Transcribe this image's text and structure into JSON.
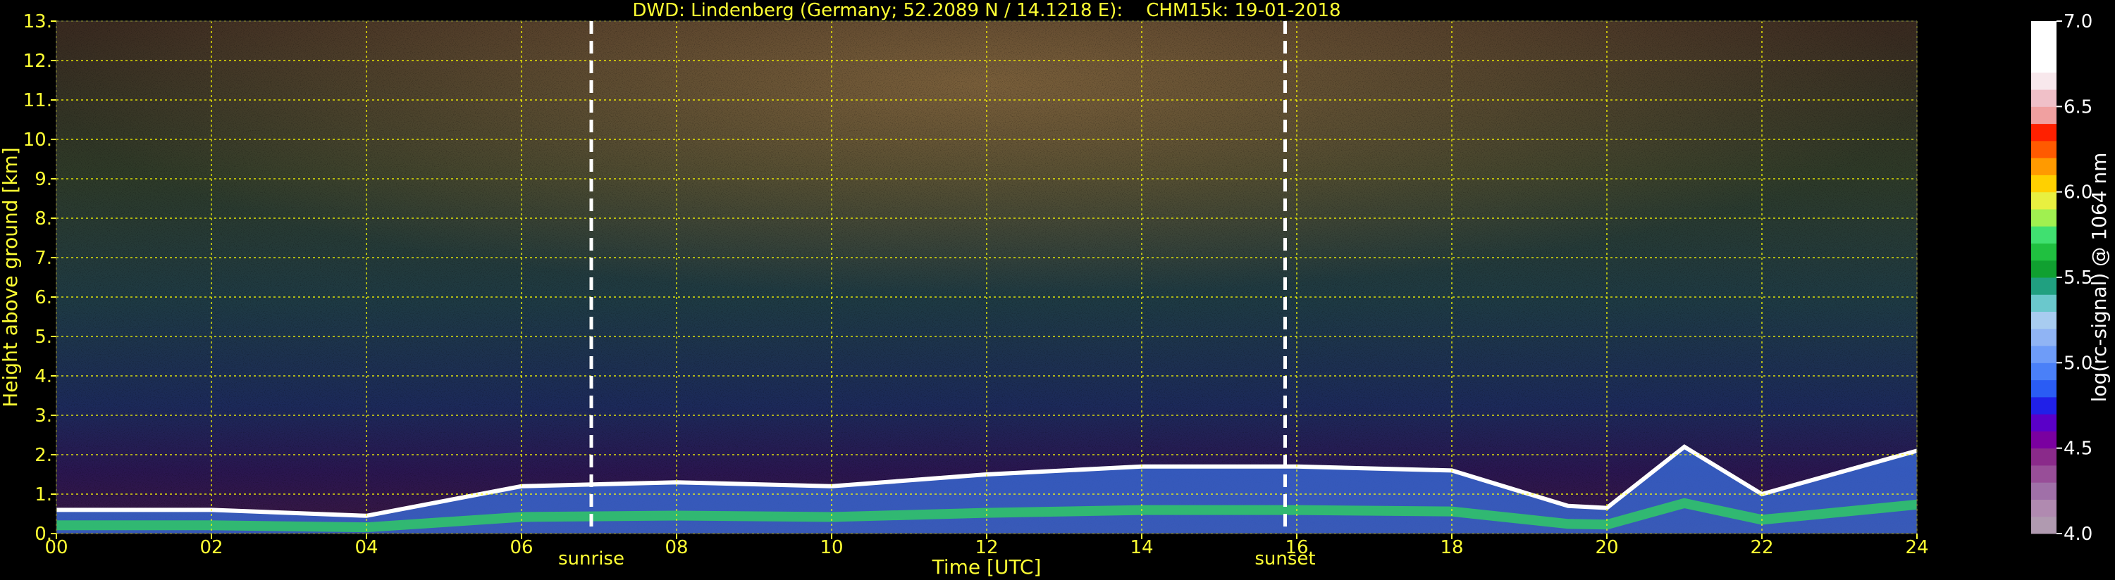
{
  "colors": {
    "background": "#000000",
    "text": "#ffff33",
    "grid": "#ffff00",
    "sun_lines": "#ffffff",
    "colorbar_text": "#ffffff"
  },
  "chart_data": {
    "type": "heatmap",
    "title": "DWD: Lindenberg (Germany; 52.2089 N / 14.1218 E):    CHM15k: 19-01-2018",
    "xlabel": "Time [UTC]",
    "ylabel": "Height above ground [km]",
    "xlim": [
      0,
      24
    ],
    "ylim": [
      0,
      13
    ],
    "x_ticks": [
      0,
      2,
      4,
      6,
      8,
      10,
      12,
      14,
      16,
      18,
      20,
      22,
      24
    ],
    "x_tick_labels": [
      "00",
      "02",
      "04",
      "06",
      "08",
      "10",
      "12",
      "14",
      "16",
      "18",
      "20",
      "22",
      "24"
    ],
    "y_ticks": [
      0,
      1,
      2,
      3,
      4,
      5,
      6,
      7,
      8,
      9,
      10,
      11,
      12,
      13
    ],
    "y_tick_labels": [
      "0.",
      "1.",
      "2.",
      "3.",
      "4.",
      "5.",
      "6.",
      "7.",
      "8.",
      "9.",
      "10.",
      "11.",
      "12.",
      "13."
    ],
    "grid": true,
    "markers": [
      {
        "label": "sunrise",
        "time": 6.9
      },
      {
        "label": "sunset",
        "time": 15.85
      }
    ],
    "colorbar": {
      "label": "log(rc-signal) @ 1064 nm",
      "range": [
        4.0,
        7.0
      ],
      "ticks": [
        4.0,
        4.5,
        5.0,
        5.5,
        6.0,
        6.5,
        7.0
      ],
      "tick_labels": [
        "4.0",
        "4.5",
        "5.0",
        "5.5",
        "6.0",
        "6.5",
        "7.0"
      ],
      "colors": [
        "#b09ab0",
        "#b08ab0",
        "#a070a8",
        "#984e98",
        "#8a2a8a",
        "#7a00a0",
        "#5a00c8",
        "#2020e8",
        "#2a5cf4",
        "#4a80f8",
        "#6e9cf8",
        "#90b4f4",
        "#a8ccf0",
        "#6ac8cc",
        "#20a080",
        "#10a030",
        "#20c040",
        "#40e070",
        "#a0f050",
        "#e8f040",
        "#ffd000",
        "#ff9a00",
        "#ff5a00",
        "#ff2000",
        "#f0a0a0",
        "#f0c0c8",
        "#f8e8ec",
        "#ffffff",
        "#ffffff",
        "#ffffff"
      ]
    },
    "boundary_layer_top_km": [
      {
        "time": 0.0,
        "height": 0.6
      },
      {
        "time": 2.0,
        "height": 0.6
      },
      {
        "time": 4.0,
        "height": 0.45
      },
      {
        "time": 6.0,
        "height": 1.2
      },
      {
        "time": 8.0,
        "height": 1.3
      },
      {
        "time": 10.0,
        "height": 1.2
      },
      {
        "time": 12.0,
        "height": 1.5
      },
      {
        "time": 14.0,
        "height": 1.7
      },
      {
        "time": 16.0,
        "height": 1.7
      },
      {
        "time": 18.0,
        "height": 1.6
      },
      {
        "time": 19.5,
        "height": 0.7
      },
      {
        "time": 20.0,
        "height": 0.65
      },
      {
        "time": 21.0,
        "height": 2.2
      },
      {
        "time": 22.0,
        "height": 1.0
      },
      {
        "time": 24.0,
        "height": 2.1
      }
    ]
  }
}
